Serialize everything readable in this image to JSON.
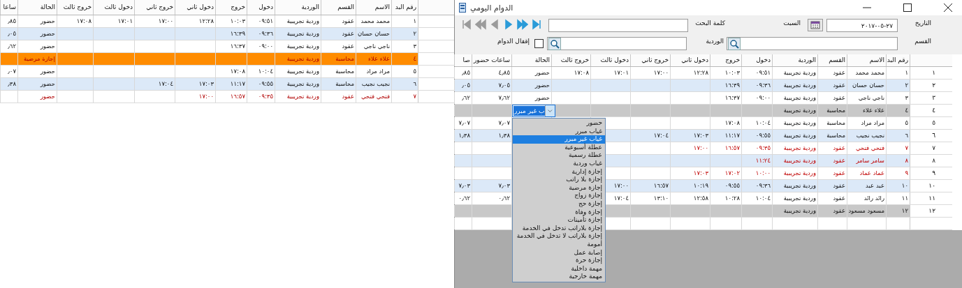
{
  "background_table": {
    "columns": [
      "رقم البد",
      "الاسم",
      "القسم",
      "الوردية",
      "دخول",
      "خروج",
      "دخول ثاني",
      "خروج ثاني",
      "دخول ثالث",
      "خروج ثالث",
      "الحالة",
      "ساعا"
    ],
    "rows": [
      {
        "cells": [
          "١",
          "محمد محمد",
          "عقود",
          "وردية تجريبية",
          "٠٩:٥١",
          "١٠:٠٣",
          "١٢:٢٨",
          "١٧:٠٠",
          "١٧:٠١",
          "١٧:٠٨",
          "حضور",
          "٫٨٥"
        ],
        "color": "#ffffff",
        "flagged": false
      },
      {
        "cells": [
          "٢",
          "حسان حسان",
          "عقود",
          "وردية تجريبية",
          "٠٩:٣٦",
          "١٦:٣٩",
          null,
          null,
          null,
          null,
          "حضور",
          "٫٠٥"
        ],
        "color": "#dce9f8",
        "flagged": false
      },
      {
        "cells": [
          "٣",
          "ناجي ناجي",
          "عقود",
          "وردية تجريبية",
          "٠٩:٠٠",
          "١٦:٣٧",
          null,
          null,
          null,
          null,
          "حضور",
          "٫٦٢"
        ],
        "color": "#ffffff",
        "flagged": false
      },
      {
        "cells": [
          "٤",
          "علاء علاء",
          "محاسبة",
          "وردية تجريبية",
          null,
          null,
          null,
          null,
          null,
          null,
          "إجازة مرضية"
        ],
        "color": "#ff8c00",
        "flagged": true
      },
      {
        "cells": [
          "٥",
          "مراد مراد",
          "محاسبة",
          "وردية تجريبية",
          "١٠:٠٤",
          "١٧:٠٨",
          null,
          null,
          null,
          null,
          "حضور",
          "٫٠٧"
        ],
        "color": "#ffffff",
        "flagged": false
      },
      {
        "cells": [
          "٦",
          "نجيب نجيب",
          "محاسبة",
          "وردية تجريبية",
          "٠٩:٥٥",
          "١١:١٧",
          "١٧:٠٣",
          "١٧:٠٤",
          null,
          null,
          "حضور",
          "٫٣٨"
        ],
        "color": "#dce9f8",
        "flagged": false
      },
      {
        "cells": [
          "٧",
          "فتحي فتحي",
          "عقود",
          "وردية تجريبية",
          "٠٩:٣٥",
          "١٦:٥٧",
          "١٧:٠٠",
          null,
          null,
          null,
          "حضور"
        ],
        "color": "#ffffff",
        "flagged": true
      }
    ]
  },
  "window": {
    "title": "الدوام اليومي"
  },
  "form": {
    "date_label": "التاريخ",
    "date": "٢٧-٠٥-٢٠١٧",
    "day": "السبت",
    "search_label": "كلمة البحث",
    "department_label": "القسم",
    "shift_label": "الوردية",
    "lock_label": "إقفال الدوام",
    "lock_checked": false,
    "nav_buttons": [
      {
        "kind": "first",
        "disabled": true
      },
      {
        "kind": "prev_page",
        "disabled": true
      },
      {
        "kind": "prev",
        "disabled": true
      },
      {
        "kind": "next",
        "disabled": false
      },
      {
        "kind": "next_page",
        "disabled": false
      },
      {
        "kind": "last",
        "disabled": false
      }
    ]
  },
  "grid": {
    "columns": [
      "رقم البد",
      "الاسم",
      "القسم",
      "الوردية",
      "دخول",
      "خروج",
      "دخول ثاني",
      "خروج ثاني",
      "دخول ثالث",
      "خروج ثالث",
      "الحالة",
      "ساعات حضور",
      "صا"
    ],
    "rows": [
      {
        "row_label": "١",
        "cells": [
          "١",
          "محمد محمد",
          "عقود",
          "وردية تجريبية",
          "٠٩:٥١",
          "١٠:٠٣",
          "١٢:٢٨",
          "١٧:٠٠",
          "١٧:٠١",
          "١٧:٠٨",
          "حضور",
          "٤٫٨٥",
          "٫٨٥"
        ],
        "color": "#ffffff",
        "flagged": false
      },
      {
        "row_label": "٢",
        "cells": [
          "٢",
          "حسان حسان",
          "عقود",
          "وردية تجريبية",
          "٠٩:٣٦",
          "١٦:٣٩",
          null,
          null,
          null,
          null,
          "حضور",
          "٧٫٠٥",
          "٫٠٥"
        ],
        "color": "#dce9f8",
        "flagged": false
      },
      {
        "row_label": "٣",
        "cells": [
          "٣",
          "ناجي ناجي",
          "عقود",
          "وردية تجريبية",
          "٠٩:٠٠",
          "١٦:٣٧",
          null,
          null,
          null,
          null,
          "حضور",
          "٧٫٦٢",
          "٫٦٢"
        ],
        "color": "#ffffff",
        "flagged": false
      },
      {
        "row_label": "٤",
        "cells": [
          "٤",
          "علاء علاء",
          "محاسبة",
          "وردية تجريبية"
        ],
        "color": "#c8c8c8",
        "flagged": false
      },
      {
        "row_label": "٥",
        "cells": [
          "٥",
          "مراد مراد",
          "محاسبة",
          "وردية تجريبية",
          "١٠:٠٤",
          "١٧:٠٨",
          null,
          null,
          null,
          null,
          null,
          "٧٫٠٧",
          "٧٫٠٧"
        ],
        "color": "#ffffff",
        "flagged": false
      },
      {
        "row_label": "٦",
        "cells": [
          "٦",
          "نجيب نجيب",
          "محاسبة",
          "وردية تجريبية",
          "٠٩:٥٥",
          "١١:١٧",
          "١٧:٠٣",
          "١٧:٠٤",
          null,
          null,
          null,
          "١٫٣٨",
          "١٫٣٨"
        ],
        "color": "#dce9f8",
        "flagged": false
      },
      {
        "row_label": "٧",
        "cells": [
          "٧",
          "فتحي فتحي",
          "عقود",
          "وردية تجريبية",
          "٠٩:٣٥",
          "١٦:٥٧",
          "١٧:٠٠"
        ],
        "color": "#ffffff",
        "flagged": true
      },
      {
        "row_label": "٨",
        "cells": [
          "٨",
          "سامر سامر",
          "عقود",
          "وردية تجريبية",
          "١١:٢٤"
        ],
        "color": "#dce9f8",
        "flagged": true
      },
      {
        "row_label": "٩",
        "cells": [
          "٩",
          "عماد عماد",
          "عقود",
          "وردية تجريبية",
          "١٠:٠٠",
          "١٧:٠٢",
          "١٧:٠٣"
        ],
        "color": "#ffffff",
        "flagged": true
      },
      {
        "row_label": "١٠",
        "cells": [
          "١٠",
          "عبد عبد",
          "عقود",
          "وردية تجريبية",
          "٠٩:٣٦",
          "٠٩:٥٥",
          "١٠:١٩",
          "١٦:٥٧",
          "١٧:٠٠",
          null,
          null,
          "٧٫٠٣",
          "٧٫٠٣"
        ],
        "color": "#dce9f8",
        "flagged": false
      },
      {
        "row_label": "١١",
        "cells": [
          "١١",
          "رائد رائد",
          "عقود",
          "وردية تجريبية",
          "١٠:٠٤",
          "١٠:٢٨",
          "١٢:٥٨",
          "١٣:١٠",
          "١٧:٠٤",
          null,
          null,
          "٠٫٦٢",
          "٠٫٦٢"
        ],
        "color": "#ffffff",
        "flagged": false
      },
      {
        "row_label": "١٢",
        "cells": [
          "١٢",
          "مسعود مسعود",
          "عقود",
          "وردية تجريبية"
        ],
        "color": "#c8c8c8",
        "flagged": false
      }
    ],
    "status_editor": {
      "value": "ب غير مبرر",
      "expanded": true,
      "options": [
        {
          "label": "حضور",
          "selected": false
        },
        {
          "label": "غياب مبرر",
          "selected": false
        },
        {
          "label": "غياب غير مبرر",
          "selected": true
        },
        {
          "label": "عطلة أسبوعية",
          "selected": false
        },
        {
          "label": "عطلة رسمية",
          "selected": false
        },
        {
          "label": "غياب وردية",
          "selected": false
        },
        {
          "label": "إجازة إدارية",
          "selected": false
        },
        {
          "label": "إجازة بلا راتب",
          "selected": false
        },
        {
          "label": "إجازة مرضية",
          "selected": false
        },
        {
          "label": "إجازة زواج",
          "selected": false
        },
        {
          "label": "إجازة حج",
          "selected": false
        },
        {
          "label": "إجازة وفاة",
          "selected": false
        },
        {
          "label": "إجازة تأمينات",
          "selected": false
        },
        {
          "label": "إجازة بلاراتب تدخل في الخدمة",
          "selected": false
        },
        {
          "label": "إجازة بلاراتب لا تدخل في الخدمة",
          "selected": false
        },
        {
          "label": "أمومة",
          "selected": false
        },
        {
          "label": "إصابة عمل",
          "selected": false
        },
        {
          "label": "إجازة حرة",
          "selected": false
        },
        {
          "label": "مهمة داخلية",
          "selected": false
        },
        {
          "label": "مهمة خارجية",
          "selected": false
        }
      ]
    }
  }
}
